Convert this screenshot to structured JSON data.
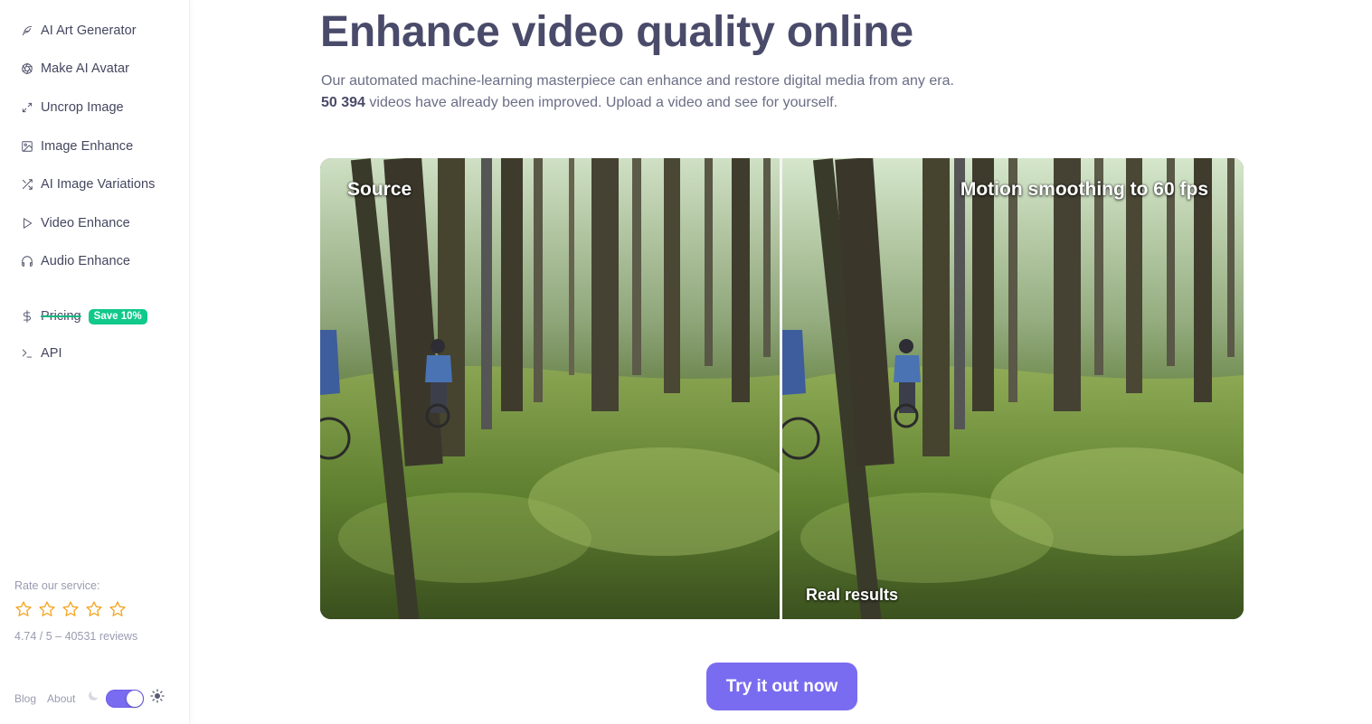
{
  "sidebar": {
    "items": [
      {
        "label": "AI Art Generator",
        "icon": "feather-icon"
      },
      {
        "label": "Make AI Avatar",
        "icon": "aperture-icon"
      },
      {
        "label": "Uncrop Image",
        "icon": "expand-icon"
      },
      {
        "label": "Image Enhance",
        "icon": "image-icon"
      },
      {
        "label": "AI Image Variations",
        "icon": "shuffle-icon"
      },
      {
        "label": "Video Enhance",
        "icon": "play-icon"
      },
      {
        "label": "Audio Enhance",
        "icon": "headphones-icon"
      }
    ],
    "pricing": {
      "label": "Pricing",
      "icon": "dollar-icon",
      "badge": "Save 10%"
    },
    "api": {
      "label": "API",
      "icon": "terminal-icon"
    },
    "rating": {
      "label": "Rate our service:",
      "stars": 5,
      "summary": "4.74 / 5 – 40531 reviews"
    },
    "footer": {
      "blog": "Blog",
      "about": "About",
      "theme": "light"
    }
  },
  "main": {
    "title": "Enhance video quality online",
    "subtitle_line1": "Our automated machine-learning masterpiece can enhance and restore digital media from any era.",
    "count": "50 394",
    "subtitle_line2_rest": " videos have already been improved. Upload a video and see for yourself.",
    "compare": {
      "left_label": "Source",
      "right_label": "Motion smoothing to 60 fps",
      "bottom_label": "Real results"
    },
    "cta_label": "Try it out now"
  },
  "colors": {
    "accent": "#7a6cf0",
    "badge": "#10c98a",
    "star": "#f5a623",
    "title": "#4a4b6a"
  }
}
